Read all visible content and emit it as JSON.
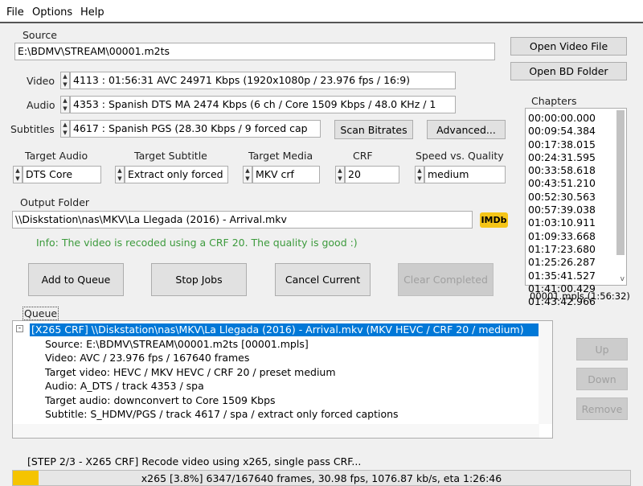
{
  "menu": [
    "File",
    "Options",
    "Help"
  ],
  "source": {
    "label": "Source",
    "value": "E:\\BDMV\\STREAM\\00001.m2ts"
  },
  "video": {
    "label": "Video",
    "value": "4113 :  01:56:31  AVC  24971 Kbps  (1920x1080p / 23.976 fps / 16:9)"
  },
  "audio": {
    "label": "Audio",
    "value": "4353 :  Spanish  DTS MA  2474 Kbps  (6 ch / Core 1509 Kbps / 48.0 KHz / 1"
  },
  "subtitles": {
    "label": "Subtitles",
    "value": "4617 :  Spanish  PGS  (28.30 Kbps / 9 forced cap"
  },
  "buttons": {
    "scan": "Scan Bitrates",
    "advanced": "Advanced...",
    "open_video": "Open Video File",
    "open_bd": "Open BD Folder",
    "add": "Add to Queue",
    "stop": "Stop Jobs",
    "cancel": "Cancel Current",
    "clear": "Clear Completed",
    "up": "Up",
    "down": "Down",
    "remove": "Remove",
    "imdb": "IMDb"
  },
  "targets": [
    {
      "label": "Target Audio",
      "value": "DTS Core"
    },
    {
      "label": "Target Subtitle",
      "value": "Extract only forced"
    },
    {
      "label": "Target Media",
      "value": "MKV crf"
    },
    {
      "label": "CRF",
      "value": "20"
    },
    {
      "label": "Speed vs. Quality",
      "value": "medium"
    }
  ],
  "output": {
    "label": "Output Folder",
    "value": "\\\\Diskstation\\nas\\MKV\\La Llegada (2016) - Arrival.mkv"
  },
  "info": "Info: The video is recoded using a CRF 20. The quality is good :)",
  "info_color": "#3c9a3c",
  "chapters": {
    "label": "Chapters",
    "items": [
      "00:00:00.000",
      "00:09:54.384",
      "00:17:38.015",
      "00:24:31.595",
      "00:33:58.618",
      "00:43:51.210",
      "00:52:30.563",
      "00:57:39.038",
      "01:03:10.911",
      "01:09:33.668",
      "01:17:23.680",
      "01:25:26.287",
      "01:35:41.527",
      "01:41:00.429",
      "01:43:42.966"
    ],
    "playlist": "00001.mpls (1:56:32)"
  },
  "queue": {
    "label": "Queue",
    "job": "[X265 CRF]     \\\\Diskstation\\nas\\MKV\\La Llegada (2016) - Arrival.mkv (MKV HEVC / CRF 20 / medium)",
    "details": [
      "Source: E:\\BDMV\\STREAM\\00001.m2ts  [00001.mpls]",
      "Video: AVC / 23.976 fps / 167640 frames",
      "Target video: HEVC / MKV HEVC / CRF 20 / preset medium",
      "Audio: A_DTS / track 4353 / spa",
      "Target audio: downconvert to Core 1509 Kbps",
      "Subtitle: S_HDMV/PGS / track 4617 / spa / extract only forced captions"
    ]
  },
  "status": "[STEP 2/3 - X265 CRF] Recode video using x265, single pass CRF...",
  "progress": {
    "percent": 3.8,
    "text": "x265 [3.8%] 6347/167640 frames, 30.98 fps, 1076.87 kb/s, eta 1:26:46",
    "color": "#f5c400"
  },
  "selection_color": "#0078d7"
}
